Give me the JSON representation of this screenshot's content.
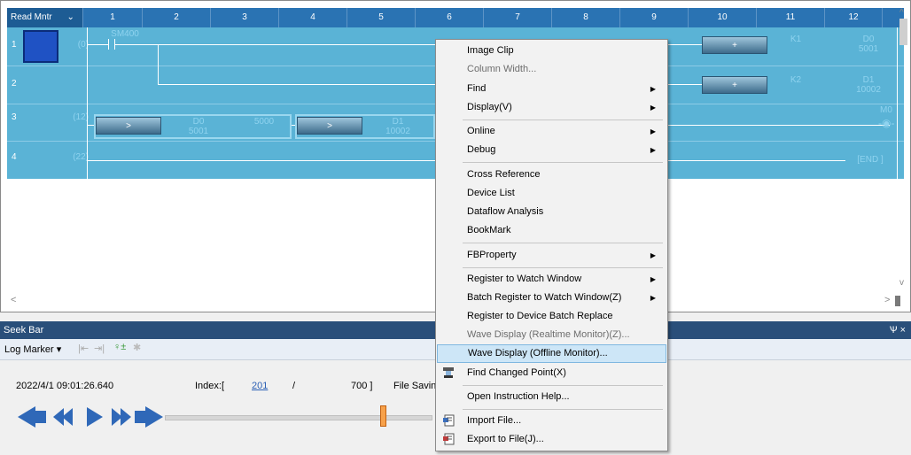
{
  "ladder": {
    "header_first": "Read Mntr",
    "columns": [
      "1",
      "2",
      "3",
      "4",
      "5",
      "6",
      "7",
      "8",
      "9",
      "10",
      "11",
      "12"
    ],
    "rows": [
      {
        "num": "1",
        "step": "(0)"
      },
      {
        "num": "2",
        "step": ""
      },
      {
        "num": "3",
        "step": "(12)"
      },
      {
        "num": "4",
        "step": "(22)"
      }
    ],
    "contact_sm400": "SM400",
    "inst_plus_1": "+",
    "inst_plus_2": "+",
    "k1": "K1",
    "k2": "K2",
    "d0_name": "D0",
    "d0_val": "5001",
    "d1_name": "D1",
    "d1_val": "10002",
    "cmp1_op": ">",
    "cmp1_dev": "D0",
    "cmp1_val": "5001",
    "cmp1_const": "5000",
    "cmp2_op": ">",
    "cmp2_dev": "D1",
    "cmp2_val": "10002",
    "coil_m0": "M0",
    "end": "END"
  },
  "seek_bar": {
    "title": "Seek Bar",
    "pin": "Ѱ ×",
    "log_marker": "Log Marker",
    "timestamp": "2022/4/1 09:01:26.640",
    "index_label": "Index:[",
    "index_value": "201",
    "slash": "/",
    "index_total": "700 ]",
    "file_saving": "File Savin",
    "slider_position_pct": 81
  },
  "context_menu": {
    "items": [
      {
        "label": "Image Clip",
        "disabled": false
      },
      {
        "label": "Column Width...",
        "disabled": true
      },
      {
        "label": "Find",
        "disabled": false,
        "submenu": true
      },
      {
        "label": "Display(V)",
        "disabled": false,
        "submenu": true
      },
      {
        "label": "Online",
        "disabled": false,
        "submenu": true
      },
      {
        "label": "Debug",
        "disabled": false,
        "submenu": true
      },
      {
        "label": "Cross Reference",
        "disabled": false
      },
      {
        "label": "Device List",
        "disabled": false
      },
      {
        "label": "Dataflow Analysis",
        "disabled": false
      },
      {
        "label": "BookMark",
        "disabled": false
      },
      {
        "label": "FBProperty",
        "disabled": false,
        "submenu": true
      },
      {
        "label": "Register to Watch Window",
        "disabled": false,
        "submenu": true
      },
      {
        "label": "Batch Register to Watch Window(Z)",
        "disabled": false,
        "submenu": true
      },
      {
        "label": "Register to Device Batch Replace",
        "disabled": false
      },
      {
        "label": "Wave Display (Realtime Monitor)(Z)...",
        "disabled": true
      },
      {
        "label": "Wave Display (Offline Monitor)...",
        "disabled": false,
        "highlighted": true
      },
      {
        "label": "Find Changed Point(X)",
        "disabled": false
      },
      {
        "label": "Open Instruction Help...",
        "disabled": false
      },
      {
        "label": "Import File...",
        "disabled": false
      },
      {
        "label": "Export to File(J)...",
        "disabled": false
      }
    ]
  }
}
